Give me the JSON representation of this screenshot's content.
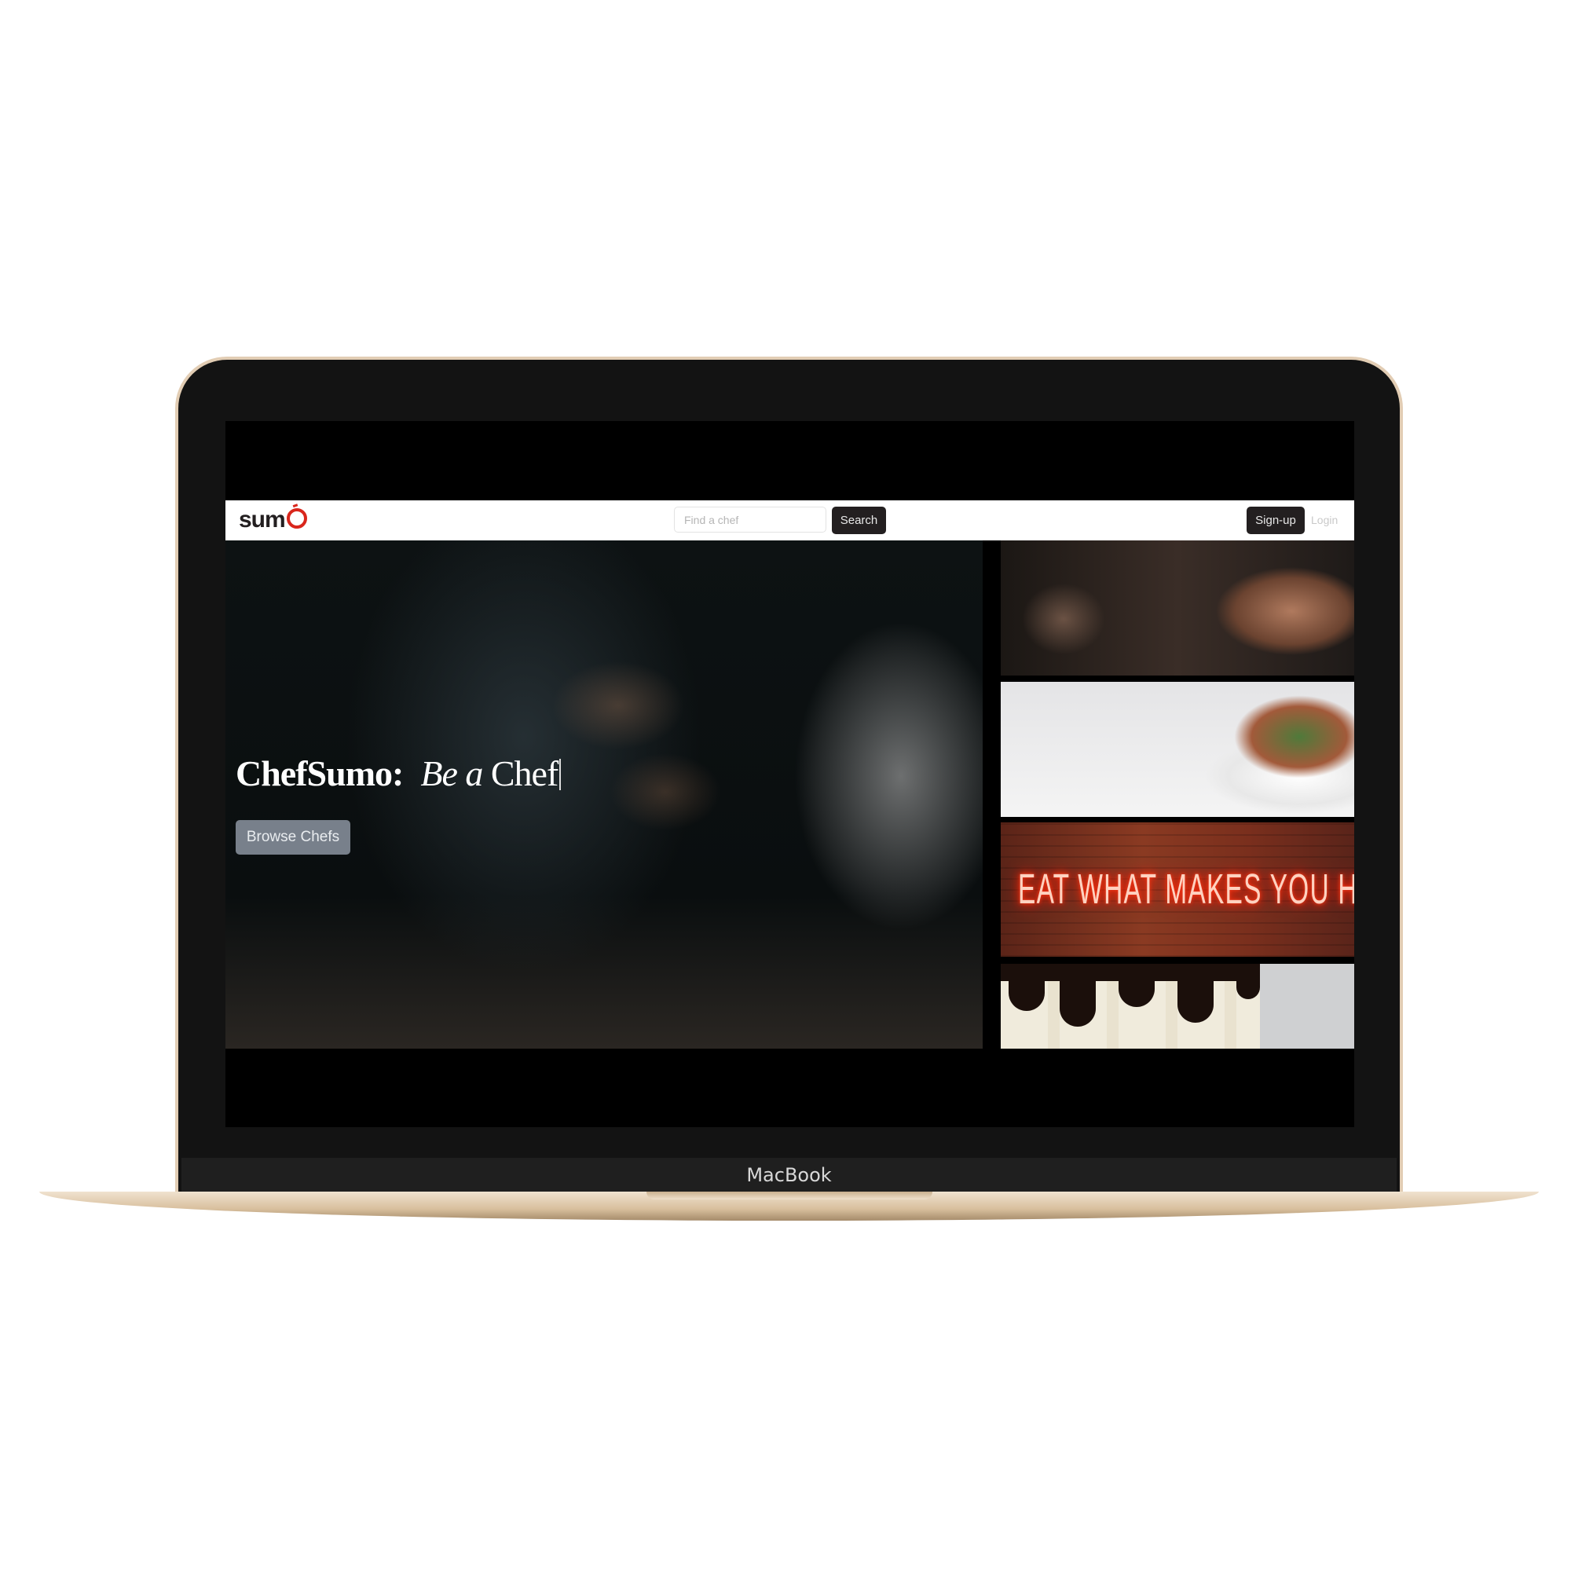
{
  "device": {
    "label": "MacBook"
  },
  "navbar": {
    "logo_text": "sumo",
    "search": {
      "placeholder": "Find a chef",
      "value": ""
    },
    "search_label": "Search",
    "signup_label": "Sign-up",
    "login_label": "Login"
  },
  "hero": {
    "brand": "ChefSumo:",
    "tagline_italic": "Be a",
    "tagline_word": "Chef",
    "browse_label": "Browse Chefs"
  },
  "gallery": {
    "neon_sign": "EAT WHAT MAKES YOU HAPPY"
  },
  "colors": {
    "accent": "#d9261c",
    "dark_button": "#231f20",
    "browse_button": "#78808b"
  }
}
